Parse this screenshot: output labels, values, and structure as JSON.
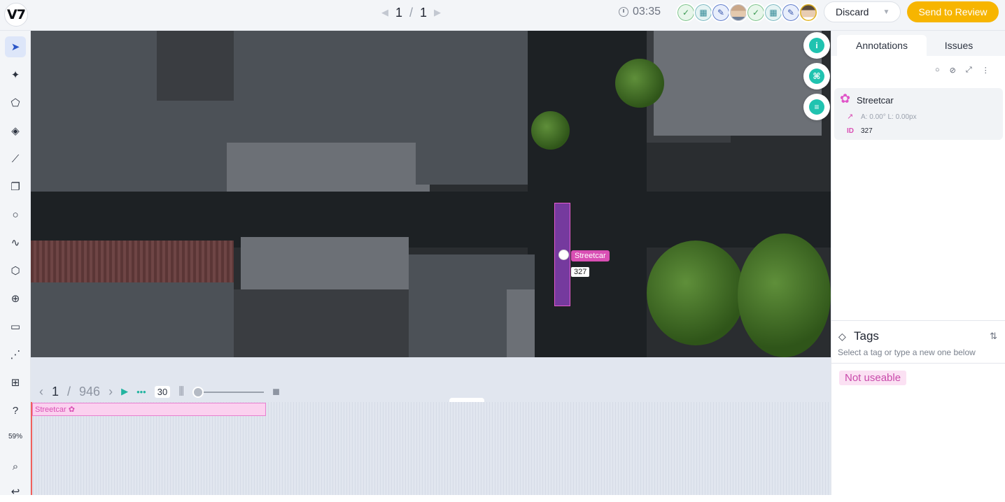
{
  "topbar": {
    "logo": "V7",
    "pager": {
      "current": "1",
      "separator": "/",
      "total": "1"
    },
    "timer": "03:35",
    "discard_label": "Discard",
    "send_label": "Send to Review"
  },
  "canvas": {
    "annotation_label": "Streetcar",
    "annotation_id": "327"
  },
  "timeline": {
    "frame_current": "1",
    "frame_separator": "/",
    "frame_total": "946",
    "fps": "30",
    "track_label": "Streetcar"
  },
  "leftbar": {
    "zoom": "59%"
  },
  "panel": {
    "tab_annotations": "Annotations",
    "tab_issues": "Issues",
    "annotation": {
      "name": "Streetcar",
      "meta": "A: 0.00° L: 0.00px",
      "id_label": "ID",
      "id_value": "327"
    },
    "tags_title": "Tags",
    "tags_hint": "Select a tag or type a new one below",
    "tag": "Not useable"
  },
  "colors": {
    "accent": "#f7b500",
    "annotation": "#d94fb4",
    "teal": "#20c3b0"
  }
}
